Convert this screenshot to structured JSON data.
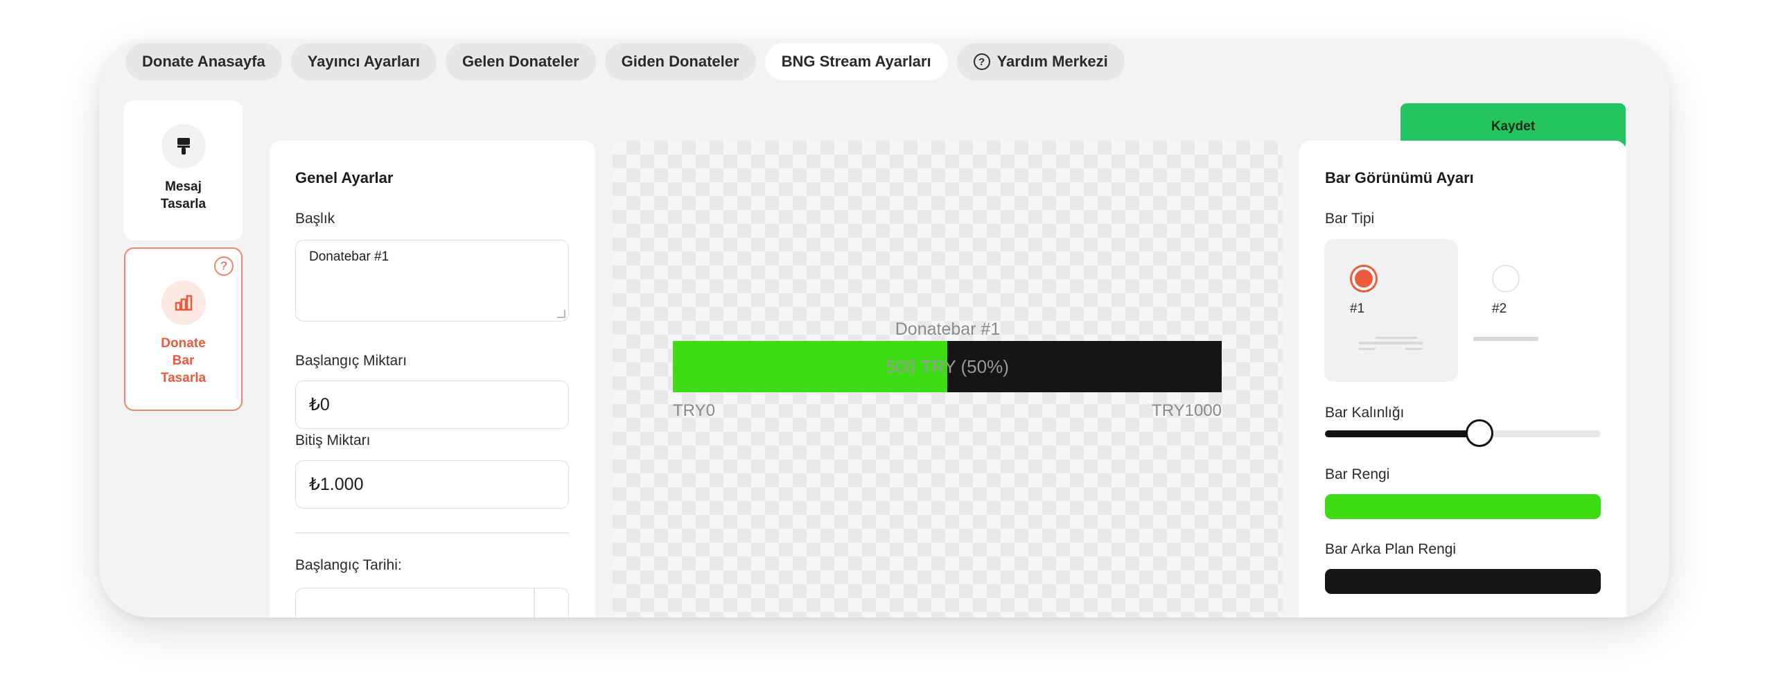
{
  "tabs": [
    {
      "label": "Donate Anasayfa"
    },
    {
      "label": "Yayıncı Ayarları"
    },
    {
      "label": "Gelen Donateler"
    },
    {
      "label": "Giden Donateler"
    },
    {
      "label": "BNG Stream Ayarları",
      "active": true
    },
    {
      "label": "Yardım Merkezi",
      "icon": "question-circle-icon"
    }
  ],
  "sidebar": {
    "items": [
      {
        "label": "Mesaj Tasarla",
        "icon": "brush-icon"
      },
      {
        "label": "Donate Bar Tasarla",
        "icon": "bar-chart-icon",
        "active": true,
        "help_icon": "question-circle-icon"
      }
    ]
  },
  "toolbar": {
    "save_label": "Kaydet"
  },
  "general": {
    "title": "Genel Ayarlar",
    "baslik_label": "Başlık",
    "baslik_value": "Donatebar #1",
    "start_amount_label": "Başlangıç Miktarı",
    "start_amount_value": "₺0",
    "end_amount_label": "Bitiş Miktarı",
    "end_amount_value": "₺1.000",
    "start_date_label": "Başlangıç Tarihi:"
  },
  "preview": {
    "title": "Donatebar #1",
    "progress": 0.5,
    "progress_text": "500 TRY (50%)",
    "min_label": "TRY0",
    "max_label": "TRY1000"
  },
  "appearance": {
    "title": "Bar Görünümü Ayarı",
    "type_label": "Bar Tipi",
    "types": [
      {
        "label": "#1",
        "selected": true
      },
      {
        "label": "#2",
        "selected": false
      }
    ],
    "thickness_label": "Bar Kalınlığı",
    "thickness": 0.56,
    "color_label": "Bar Rengi",
    "bar_color": "#3ddc15",
    "bg_color_label": "Bar Arka Plan Rengi",
    "bg_color": "#151515"
  },
  "colors": {
    "accent": "#ee5a3c",
    "save": "#22c55e"
  }
}
